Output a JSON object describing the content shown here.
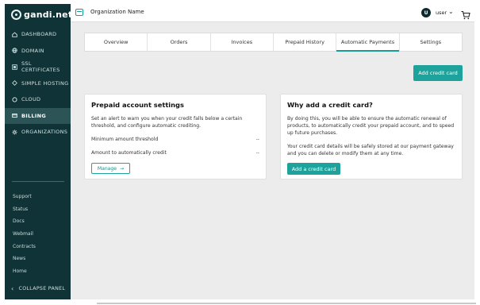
{
  "brand": {
    "logo_text": "gandi.net"
  },
  "sidebar": {
    "items": [
      {
        "label": "DASHBOARD",
        "icon": "dashboard-icon",
        "active": false
      },
      {
        "label": "DOMAIN",
        "icon": "globe-icon",
        "active": false
      },
      {
        "label": "SSL CERTIFICATES",
        "icon": "certificate-icon",
        "active": false
      },
      {
        "label": "SIMPLE HOSTING",
        "icon": "hosting-icon",
        "active": false
      },
      {
        "label": "CLOUD",
        "icon": "cloud-icon",
        "active": false
      },
      {
        "label": "BILLING",
        "icon": "billing-icon",
        "active": true
      },
      {
        "label": "ORGANIZATIONS",
        "icon": "gear-icon",
        "active": false
      }
    ],
    "links": [
      "Support",
      "Status",
      "Docs",
      "Webmail",
      "Contracts",
      "News",
      "Home"
    ],
    "collapse_label": "COLLAPSE PANEL"
  },
  "topbar": {
    "org_name": "Organization Name",
    "user_initial": "U",
    "user_name": "user"
  },
  "tabs": [
    {
      "label": "Overview",
      "active": false
    },
    {
      "label": "Orders",
      "active": false
    },
    {
      "label": "Invoices",
      "active": false
    },
    {
      "label": "Prepaid History",
      "active": false
    },
    {
      "label": "Automatic Payments",
      "active": true
    },
    {
      "label": "Settings",
      "active": false
    }
  ],
  "actions": {
    "add_credit_card": "Add credit card"
  },
  "prepaid": {
    "title": "Prepaid account settings",
    "description": "Set an alert to warn you when your credit falls below a certain threshold, and configure automatic crediting.",
    "rows": [
      {
        "label": "Minimum amount threshold",
        "value": "--"
      },
      {
        "label": "Amount to automatically credit",
        "value": "--"
      }
    ],
    "manage_label": "Manage"
  },
  "why": {
    "title": "Why add a credit card?",
    "paragraph1": "By doing this, you will be able to ensure the automatic renewal of products, to automatically credit your prepaid account, and to speed up future purchases.",
    "paragraph2": "Your credit card details will be safely stored at our payment gateway and you can delete or modify them at any time.",
    "button_label": "Add a credit card"
  },
  "colors": {
    "sidebar_bg": "#0f3336",
    "accent": "#1ea39c",
    "page_bg": "#ececec"
  }
}
